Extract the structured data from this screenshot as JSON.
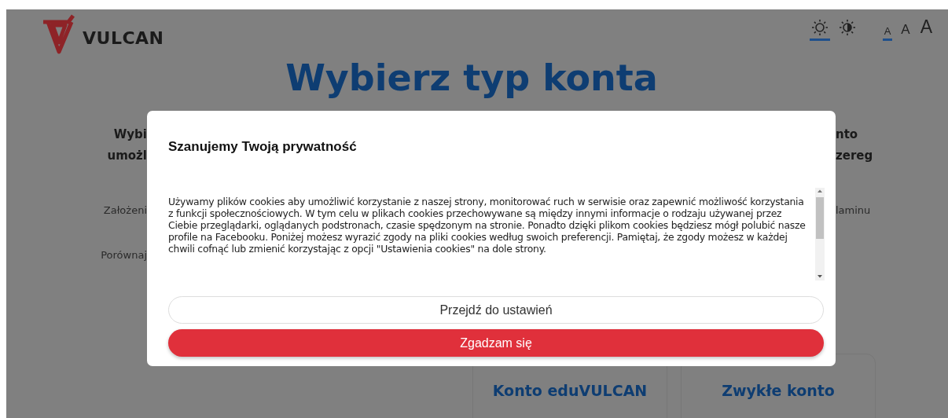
{
  "header": {
    "logo_text": "VULCAN",
    "theme_options": [
      {
        "kind": "light",
        "selected": true
      },
      {
        "kind": "contrast",
        "selected": false
      }
    ],
    "font_sizes": [
      {
        "label": "A",
        "selected": true
      },
      {
        "label": "A",
        "selected": false
      },
      {
        "label": "A",
        "selected": false
      }
    ]
  },
  "title": "Wybierz typ konta",
  "left_column": [
    "Wybi",
    "umożl",
    "Założeni",
    "Porównaj"
  ],
  "right_column": [
    "nto",
    "zereg",
    "laminu"
  ],
  "cards": [
    "Konto eduVULCAN",
    "Zwykłe konto"
  ],
  "modal": {
    "title": "Szanujemy Twoją prywatność",
    "text": "Używamy plików cookies aby umożliwić korzystanie z naszej strony, monitorować ruch w serwisie oraz zapewnić możliwość korzystania z funkcji społecznościowych. W tym celu w plikach cookies przechowywane są między innymi informacje o rodzaju używanej przez Ciebie przeglądarki, oglądanych podstronach, czasie spędzonym na stronie. Ponadto dzięki plikom cookies będziesz mógł polubić nasze profile na Facebooku. Poniżej możesz wyrazić zgody na pliki cookies według swoich preferencji. Pamiętaj, że zgody możesz w każdej chwili cofnąć lub zmienić korzystając z opcji \"Ustawienia cookies\" na dole strony.",
    "buttons": [
      {
        "kind": "secondary",
        "label": "Przejdź do ustawień"
      },
      {
        "kind": "primary",
        "label": "Zgadzam się"
      }
    ]
  }
}
